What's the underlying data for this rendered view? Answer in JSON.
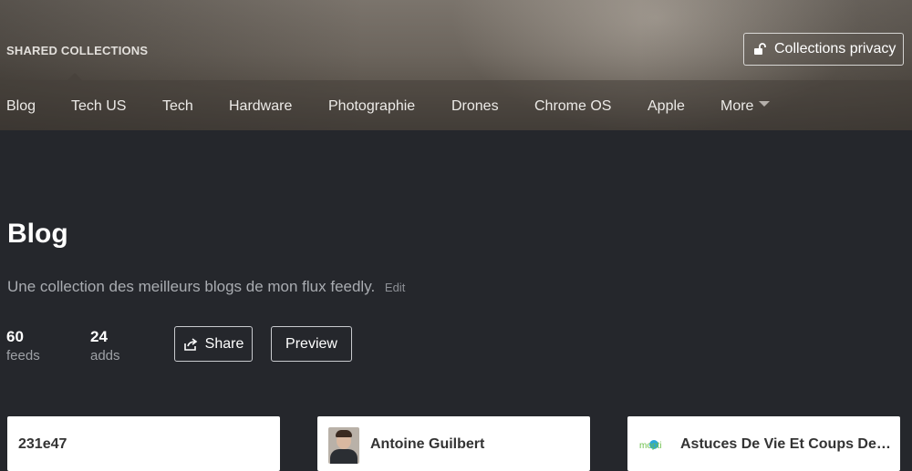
{
  "header": {
    "section_label": "SHARED COLLECTIONS",
    "privacy_button": {
      "label": "Collections privacy",
      "icon": "lock-icon"
    }
  },
  "nav": {
    "items": [
      "Blog",
      "Tech US",
      "Tech",
      "Hardware",
      "Photographie",
      "Drones",
      "Chrome OS",
      "Apple"
    ],
    "more_label": "More"
  },
  "collection": {
    "title": "Blog",
    "description": "Une collection des meilleurs blogs de mon flux feedly.",
    "edit_label": "Edit",
    "stats": [
      {
        "value": "60",
        "label": "feeds"
      },
      {
        "value": "24",
        "label": "adds"
      }
    ],
    "share_label": "Share",
    "share_icon": "share-icon",
    "preview_label": "Preview"
  },
  "cards": [
    {
      "title": "231e47"
    },
    {
      "title": "Antoine Guilbert",
      "icon": "avatar"
    },
    {
      "title": "Astuces De Vie Et Coups De…",
      "icon": "mopti-logo-icon",
      "logo_text": "mopti"
    }
  ],
  "colors": {
    "background": "#25272c",
    "card_background": "#ffffff",
    "muted_text": "#a9acb1"
  }
}
